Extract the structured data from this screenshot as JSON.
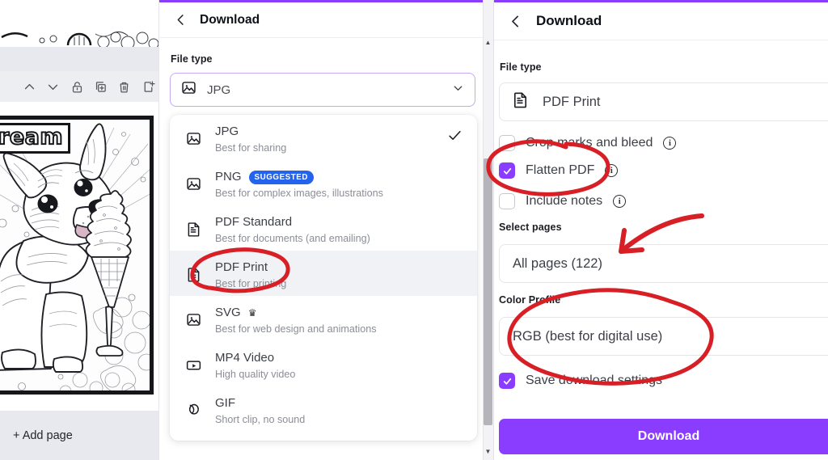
{
  "editor": {
    "toolbar_icons": [
      "move-up-icon",
      "move-down-icon",
      "lock-icon",
      "duplicate-page-icon",
      "delete-icon",
      "export-icon"
    ],
    "artwork_text": "ream",
    "artwork_name": "corgi-ice-cream-coloring-page",
    "add_page_label": "+ Add page"
  },
  "middle_panel": {
    "back_icon": "chevron-left-icon",
    "title": "Download",
    "file_type_label": "File type",
    "selected": {
      "value": "JPG",
      "icon": "image-icon",
      "chevron": "chevron-down-icon"
    },
    "options": [
      {
        "title": "JPG",
        "subtitle": "Best for sharing",
        "icon": "image-icon",
        "badge": "",
        "crown": false,
        "checked": true,
        "highlighted": false
      },
      {
        "title": "PNG",
        "subtitle": "Best for complex images, illustrations",
        "icon": "image-icon",
        "badge": "SUGGESTED",
        "crown": false,
        "checked": false,
        "highlighted": false
      },
      {
        "title": "PDF Standard",
        "subtitle": "Best for documents (and emailing)",
        "icon": "document-icon",
        "badge": "",
        "crown": false,
        "checked": false,
        "highlighted": false
      },
      {
        "title": "PDF Print",
        "subtitle": "Best for printing",
        "icon": "document-icon",
        "badge": "",
        "crown": false,
        "checked": false,
        "highlighted": true
      },
      {
        "title": "SVG",
        "subtitle": "Best for web design and animations",
        "icon": "image-icon",
        "badge": "",
        "crown": true,
        "checked": false,
        "highlighted": false
      },
      {
        "title": "MP4 Video",
        "subtitle": "High quality video",
        "icon": "video-icon",
        "badge": "",
        "crown": false,
        "checked": false,
        "highlighted": false
      },
      {
        "title": "GIF",
        "subtitle": "Short clip, no sound",
        "icon": "gif-icon",
        "badge": "",
        "crown": false,
        "checked": false,
        "highlighted": false
      }
    ]
  },
  "scrollbar": {
    "up_glyph": "▲",
    "down_glyph": "▼"
  },
  "right_panel": {
    "back_icon": "chevron-left-icon",
    "title": "Download",
    "file_type_label": "File type",
    "file_type_value": "PDF Print",
    "file_type_icon": "document-icon",
    "checkboxes": [
      {
        "label": "Crop marks and bleed",
        "checked": false,
        "info": true
      },
      {
        "label": "Flatten PDF",
        "checked": true,
        "info": true
      },
      {
        "label": "Include notes",
        "checked": false,
        "info": true
      }
    ],
    "select_pages_label": "Select pages",
    "select_pages_value": "All pages (122)",
    "color_profile_label": "Color Profile",
    "color_profile_value": "RGB (best for digital use)",
    "save_settings": {
      "label": "Save download settings",
      "checked": true
    },
    "download_button": "Download"
  },
  "annotations": {
    "color": "#d81f26",
    "shapes": [
      {
        "name": "ellipse-pdf-print",
        "type": "ellipse"
      },
      {
        "name": "ellipse-flatten-pdf",
        "type": "ellipse"
      },
      {
        "name": "arrow-to-select-pages",
        "type": "arrow"
      },
      {
        "name": "ellipse-color-profile",
        "type": "ellipse"
      }
    ]
  },
  "colors": {
    "accent_purple": "#8b3dff",
    "badge_blue": "#2463eb",
    "annotation_red": "#d81f26",
    "panel_border": "#e6e6ea",
    "text_primary": "#3c3f46",
    "text_muted": "#8b8e95"
  }
}
